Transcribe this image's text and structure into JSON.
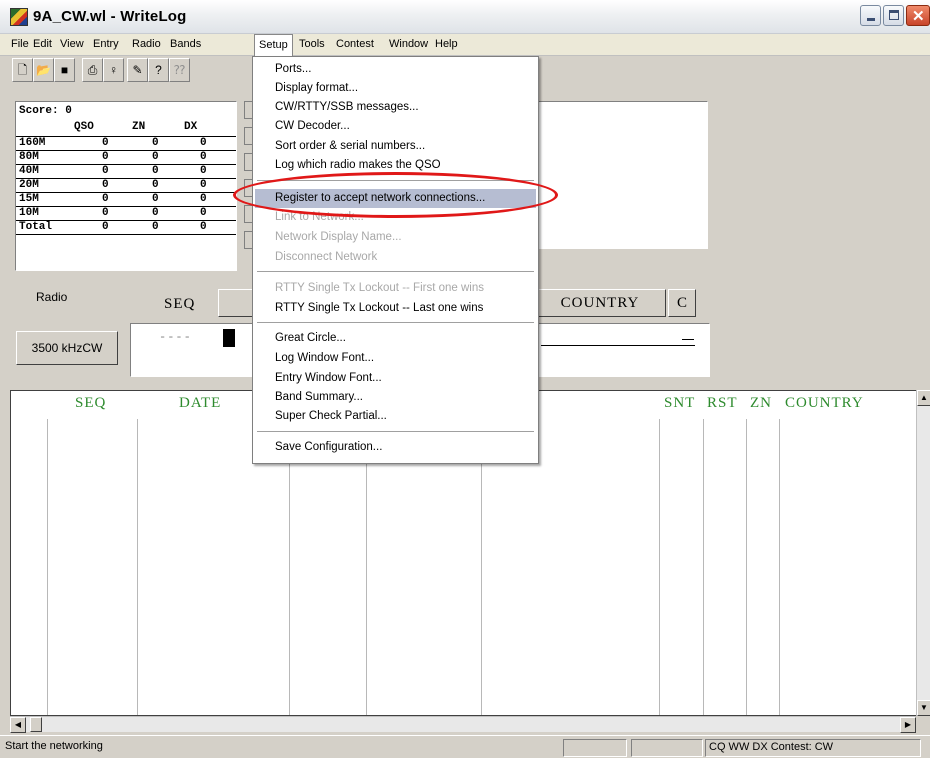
{
  "window": {
    "title": "9A_CW.wl - WriteLog",
    "controls": [
      "minimize",
      "maximize",
      "close"
    ]
  },
  "menubar": {
    "items": [
      "File",
      "Edit",
      "View",
      "Entry",
      "Radio",
      "Bands",
      "Setup",
      "Tools",
      "Contest",
      "Window",
      "Help"
    ],
    "active": "Setup"
  },
  "toolbar": {
    "icons": [
      "new-file-icon",
      "open-file-icon",
      "save-icon",
      "print-icon",
      "antenna-icon",
      "pencil-icon",
      "help-icon",
      "context-help-icon"
    ]
  },
  "score": {
    "title": "Score: 0",
    "headers": [
      "QSO",
      "ZN",
      "DX"
    ],
    "rows": [
      {
        "band": "160M",
        "qso": "0",
        "zn": "0",
        "dx": "0"
      },
      {
        "band": "80M",
        "qso": "0",
        "zn": "0",
        "dx": "0"
      },
      {
        "band": "40M",
        "qso": "0",
        "zn": "0",
        "dx": "0"
      },
      {
        "band": "20M",
        "qso": "0",
        "zn": "0",
        "dx": "0"
      },
      {
        "band": "15M",
        "qso": "0",
        "zn": "0",
        "dx": "0"
      },
      {
        "band": "10M",
        "qso": "0",
        "zn": "0",
        "dx": "0"
      },
      {
        "band": "Total",
        "qso": "0",
        "zn": "0",
        "dx": "0"
      }
    ]
  },
  "entry": {
    "radio_label": "Radio",
    "seq_label": "SEQ",
    "country_header": "COUNTRY",
    "c_header": "C",
    "frequency_button": "3500 kHzCW",
    "seq_placeholder": "----",
    "trailing_dash": "_"
  },
  "log": {
    "columns": {
      "seq": "SEQ",
      "date": "DATE",
      "snt": "SNT",
      "rst": "RST",
      "zn": "ZN",
      "country": "COUNTRY"
    }
  },
  "setup_menu": {
    "items": [
      {
        "label": "Ports...",
        "enabled": true
      },
      {
        "label": "Display format...",
        "enabled": true
      },
      {
        "label": "CW/RTTY/SSB messages...",
        "enabled": true
      },
      {
        "label": "CW Decoder...",
        "enabled": true
      },
      {
        "label": "Sort order & serial numbers...",
        "enabled": true
      },
      {
        "label": "Log which radio makes the QSO",
        "enabled": true
      },
      {
        "label": "Register to accept network connections...",
        "enabled": true,
        "highlighted": true
      },
      {
        "label": "Link to Network...",
        "enabled": false
      },
      {
        "label": "Network Display Name...",
        "enabled": false
      },
      {
        "label": "Disconnect Network",
        "enabled": false
      },
      {
        "label": "RTTY Single Tx Lockout -- First one wins",
        "enabled": false
      },
      {
        "label": "RTTY Single Tx Lockout -- Last one wins",
        "enabled": true
      },
      {
        "label": "Great Circle...",
        "enabled": true
      },
      {
        "label": "Log Window Font...",
        "enabled": true
      },
      {
        "label": "Entry Window Font...",
        "enabled": true
      },
      {
        "label": "Band Summary...",
        "enabled": true
      },
      {
        "label": "Super Check Partial...",
        "enabled": true
      },
      {
        "label": "Save Configuration...",
        "enabled": true
      }
    ]
  },
  "statusbar": {
    "message": "Start the networking",
    "contest": "CQ WW DX Contest: CW"
  },
  "colors": {
    "log_header": "#2e8b2e",
    "menu_highlight": "#b6bdd2",
    "annotation_circle": "#e01818"
  }
}
